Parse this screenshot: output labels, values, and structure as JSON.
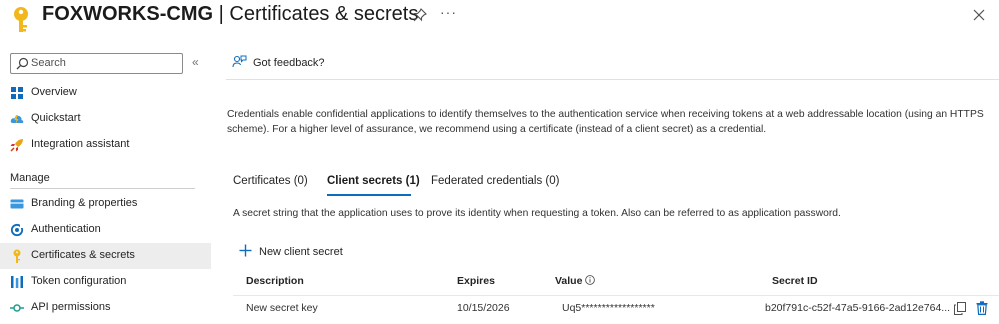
{
  "header": {
    "app_name": "FOXWORKS-CMG",
    "separator": " | ",
    "page_name": "Certificates & secrets",
    "more_label": "···"
  },
  "sidebar": {
    "search_placeholder": "Search",
    "collapse_label": "«",
    "items_top": [
      {
        "label": "Overview",
        "icon": "grid-icon"
      },
      {
        "label": "Quickstart",
        "icon": "cloud-icon"
      },
      {
        "label": "Integration assistant",
        "icon": "rocket-icon"
      }
    ],
    "manage_header": "Manage",
    "items_manage": [
      {
        "label": "Branding & properties",
        "icon": "card-icon"
      },
      {
        "label": "Authentication",
        "icon": "refresh-icon"
      },
      {
        "label": "Certificates & secrets",
        "icon": "key-icon",
        "active": true
      },
      {
        "label": "Token configuration",
        "icon": "bars-icon"
      },
      {
        "label": "API permissions",
        "icon": "permissions-icon"
      }
    ]
  },
  "main": {
    "feedback_label": "Got feedback?",
    "intro": "Credentials enable confidential applications to identify themselves to the authentication service when receiving tokens at a web addressable location (using an HTTPS scheme). For a higher level of assurance, we recommend using a certificate (instead of a client secret) as a credential.",
    "tabs": [
      {
        "label": "Certificates (0)"
      },
      {
        "label": "Client secrets (1)",
        "active": true
      },
      {
        "label": "Federated credentials (0)"
      }
    ],
    "secret_description": "A secret string that the application uses to prove its identity when requesting a token. Also can be referred to as application password.",
    "new_secret_label": "New client secret",
    "table": {
      "headers": [
        "Description",
        "Expires",
        "Value",
        "Secret ID"
      ],
      "rows": [
        {
          "description": "New secret key",
          "expires": "10/15/2026",
          "value": "Uq5******************",
          "secret_id": "b20f791c-c52f-47a5-9166-2ad12e764..."
        }
      ]
    }
  },
  "colors": {
    "accent": "#0f6cbd",
    "key_yellow": "#f2b71b",
    "active_bg": "#ededed"
  }
}
